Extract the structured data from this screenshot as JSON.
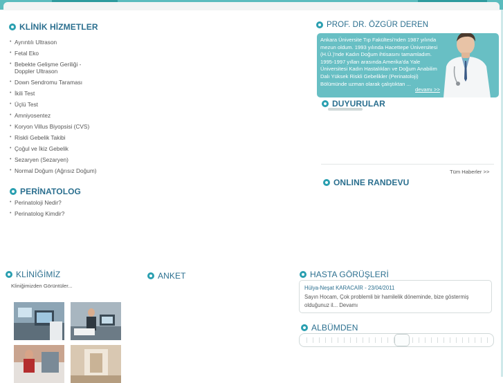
{
  "colors": {
    "accent": "#2a9fb0",
    "heading": "#2b6f8f",
    "top_bar": "#5bbcbe",
    "doctor_box": "#68bfc4"
  },
  "services": {
    "title": "KLİNİK HİZMETLER",
    "items": [
      "Ayrıntılı Ultrason",
      "Fetal Eko",
      "Bebekte Gelişme Geriliği -",
      "Doppler Ultrason",
      "Down Sendromu Taraması",
      "İkili Test",
      "Üçlü Test",
      "Amniyosentez",
      "Koryon Villus Biyopsisi (CVS)",
      "Riskli Gebelik Takibi",
      "Çoğul ve İkiz Gebelik",
      "Sezaryen (Sezaryen)",
      "Normal Doğum (Ağrısız Doğum)"
    ]
  },
  "perinatolog": {
    "title": "PERİNATOLOG",
    "items": [
      "Perinatoloji Nedir?",
      "Perinatolog Kimdir?"
    ]
  },
  "doctor": {
    "title": "PROF. DR. ÖZGÜR DEREN",
    "bio": "Ankara Üniversite Tıp Fakültesi'nden 1987 yılında mezun oldum. 1993 yılında Hacettepe Üniversitesi (H.Ü.)'nde Kadın Doğum ihtisasını tamamladım. 1995-1997 yılları arasında Amerika'da Yale Üniversitesi Kadın Hastalıkları ve Doğum Anabilim Dalı Yüksek Riskli Gebelikler (Perinatoloji) Bölümünde uzman olarak çalıştıktan ...",
    "more": "devamı >>"
  },
  "announcements": {
    "title": "DUYURULAR",
    "all_news": "Tüm Haberler >>"
  },
  "appointment": {
    "title": "ONLINE RANDEVU"
  },
  "clinic": {
    "title": "KLİNİĞİMİZ",
    "subtitle": "Kliniğimizden Görüntüler..."
  },
  "poll": {
    "title": "ANKET"
  },
  "testimonials": {
    "title": "HASTA GÖRÜŞLERİ",
    "name_date": "Hülya-Neşat KARACAİR - 23/04/2011",
    "text": "Sayın Hocam, Çok problemli bir hamilelik döneminde, bize göstermiş olduğunuz il...",
    "more": "Devamı"
  },
  "album": {
    "title": "ALBÜMDEN"
  }
}
